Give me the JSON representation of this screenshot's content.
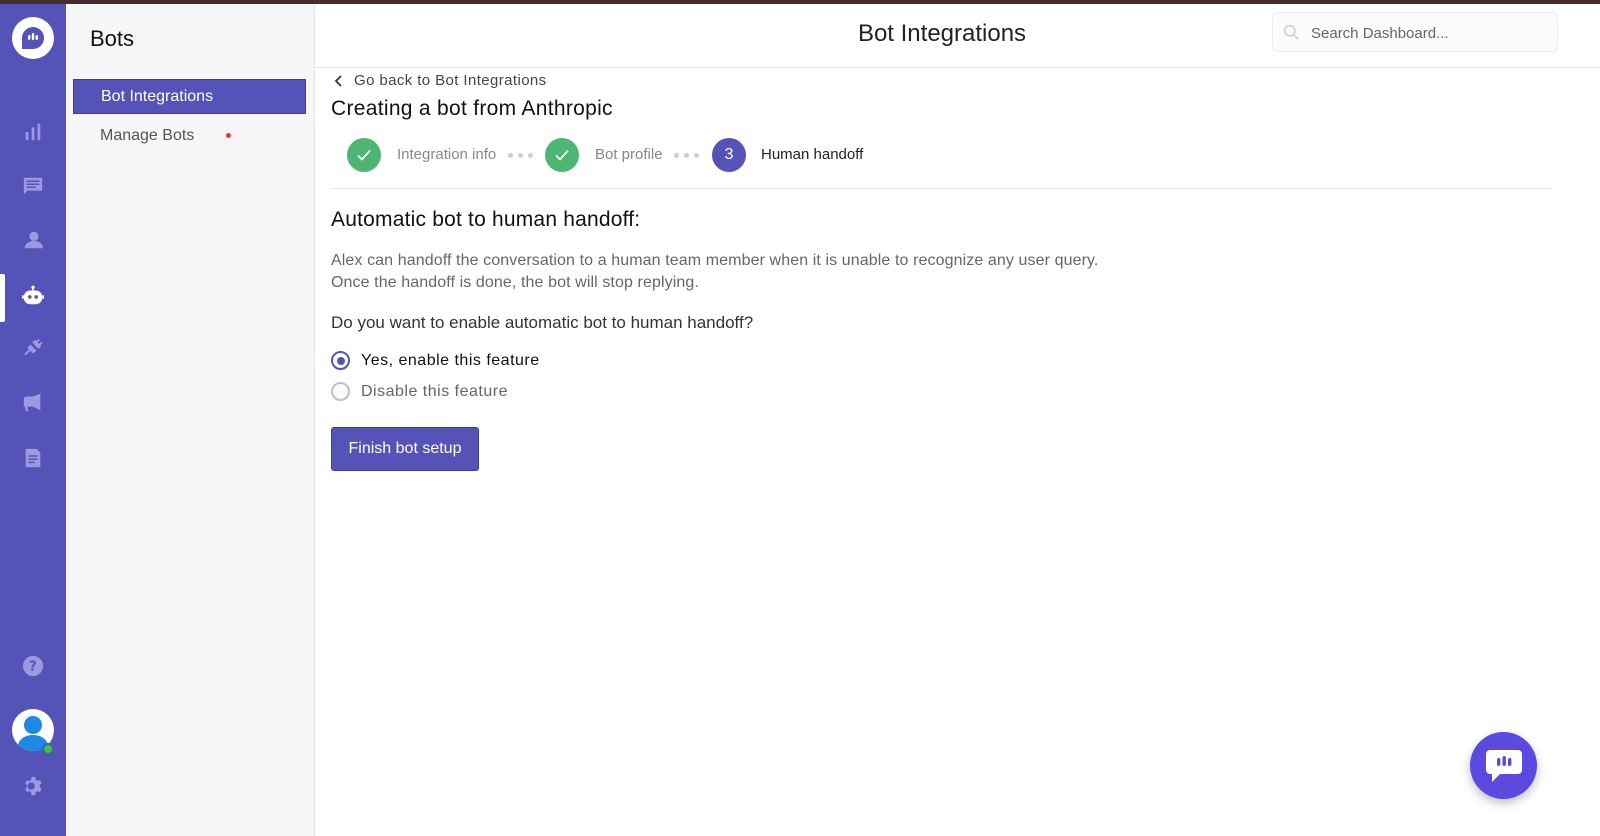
{
  "app": {
    "accent_color": "#5553b7",
    "success_color": "#4fb573"
  },
  "rail": {
    "items": [
      {
        "name": "reports",
        "icon": "bar-chart-icon"
      },
      {
        "name": "conversations",
        "icon": "message-icon"
      },
      {
        "name": "users",
        "icon": "users-icon"
      },
      {
        "name": "bots",
        "icon": "bot-icon",
        "active": true
      },
      {
        "name": "integrations",
        "icon": "plug-icon"
      },
      {
        "name": "campaigns",
        "icon": "megaphone-icon"
      },
      {
        "name": "docs",
        "icon": "document-icon"
      },
      {
        "name": "help",
        "icon": "help-icon"
      },
      {
        "name": "settings",
        "icon": "gear-icon"
      }
    ]
  },
  "subnav": {
    "title": "Bots",
    "items": [
      {
        "label": "Bot Integrations",
        "active": true
      },
      {
        "label": "Manage Bots",
        "badge": "red-dot"
      }
    ]
  },
  "header": {
    "title": "Bot Integrations",
    "search_placeholder": "Search Dashboard..."
  },
  "main": {
    "back_link": "Go back to Bot Integrations",
    "title": "Creating a bot from Anthropic",
    "steps": [
      {
        "label": "Integration info",
        "state": "done"
      },
      {
        "label": "Bot profile",
        "state": "done"
      },
      {
        "number": "3",
        "label": "Human handoff",
        "state": "current"
      }
    ],
    "section_title": "Automatic bot to human handoff:",
    "description_line1": "Alex can handoff the conversation to a human team member when it is unable to recognize any user query.",
    "description_line2": "Once the handoff is done, the bot will stop replying.",
    "question": "Do you want to enable automatic bot to human handoff?",
    "options": [
      {
        "label": "Yes, enable this feature",
        "selected": true
      },
      {
        "label": "Disable this feature",
        "selected": false
      }
    ],
    "finish_button": "Finish bot setup"
  }
}
